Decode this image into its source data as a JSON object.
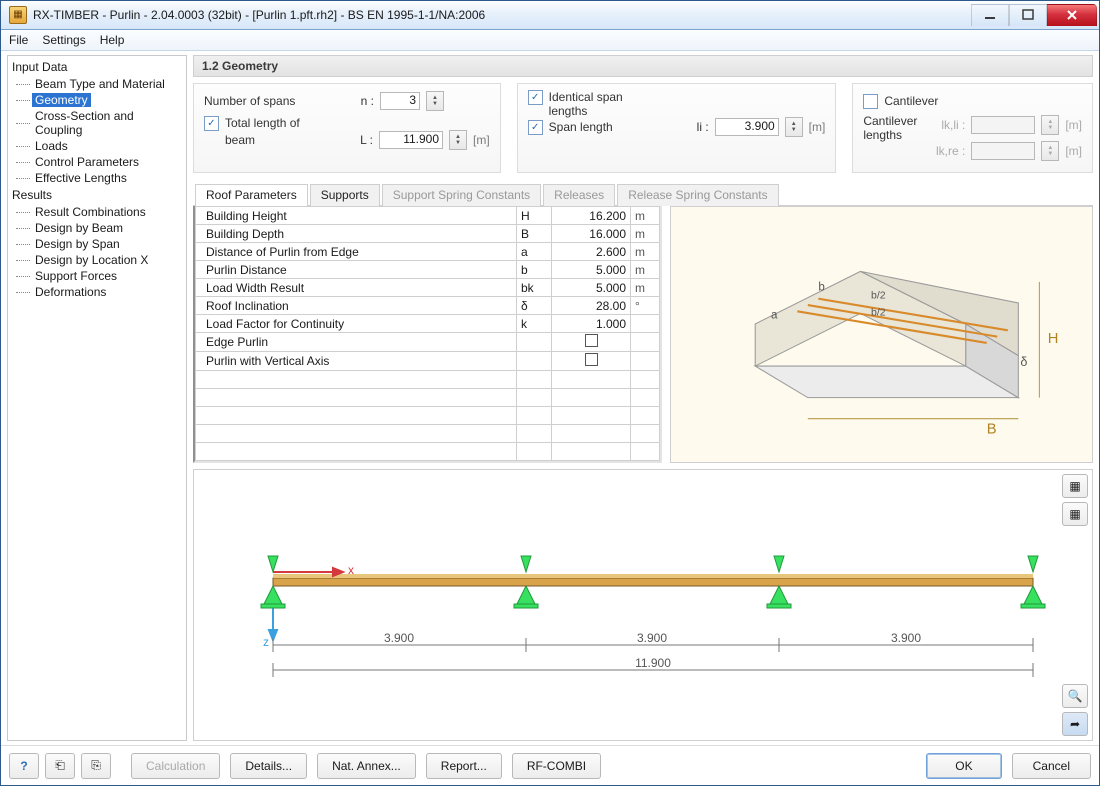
{
  "window": {
    "title": "RX-TIMBER - Purlin - 2.04.0003 (32bit) - [Purlin 1.pft.rh2] - BS EN 1995-1-1/NA:2006"
  },
  "menu": {
    "file": "File",
    "settings": "Settings",
    "help": "Help"
  },
  "tree": {
    "input": {
      "hdr": "Input Data",
      "items": [
        "Beam Type and Material",
        "Geometry",
        "Cross-Section and Coupling",
        "Loads",
        "Control Parameters",
        "Effective Lengths"
      ],
      "selected_index": 1
    },
    "results": {
      "hdr": "Results",
      "items": [
        "Result Combinations",
        "Design by Beam",
        "Design by Span",
        "Design by Location X",
        "Support Forces",
        "Deformations"
      ]
    }
  },
  "section": {
    "title": "1.2 Geometry"
  },
  "groups": {
    "spans": {
      "label": "Number of spans",
      "symbol": "n :",
      "value": "3"
    },
    "total_length": {
      "check": true,
      "label1": "Total length of",
      "label2": "beam",
      "symbol": "L :",
      "value": "11.900",
      "unit": "[m]"
    },
    "identical": {
      "check": true,
      "label1": "Identical span",
      "label2": "lengths"
    },
    "span_length": {
      "check": true,
      "label": "Span length",
      "symbol": "li :",
      "value": "3.900",
      "unit": "[m]"
    },
    "cantilever": {
      "check": false,
      "label": "Cantilever",
      "label2a": "Cantilever",
      "label2b": "lengths",
      "sym_li": "lk,li :",
      "sym_re": "lk,re :",
      "unit": "[m]"
    }
  },
  "tabs2": {
    "items": [
      "Roof Parameters",
      "Supports",
      "Support Spring Constants",
      "Releases",
      "Release Spring Constants"
    ],
    "active_index": 0
  },
  "params": {
    "rows": [
      {
        "name": "Building Height",
        "sym": "H",
        "val": "16.200",
        "un": "m"
      },
      {
        "name": "Building Depth",
        "sym": "B",
        "val": "16.000",
        "un": "m"
      },
      {
        "name": "Distance of Purlin from Edge",
        "sym": "a",
        "val": "2.600",
        "un": "m"
      },
      {
        "name": "Purlin Distance",
        "sym": "b",
        "val": "5.000",
        "un": "m"
      },
      {
        "name": "Load Width Result",
        "sym": "bk",
        "val": "5.000",
        "un": "m"
      },
      {
        "name": "Roof Inclination",
        "sym": "δ",
        "val": "28.00",
        "un": "°"
      },
      {
        "name": "Load Factor for Continuity",
        "sym": "k",
        "val": "1.000",
        "un": ""
      },
      {
        "name": "Edge Purlin",
        "sym": "",
        "val": "CHK",
        "un": ""
      },
      {
        "name": "Purlin with Vertical Axis",
        "sym": "",
        "val": "CHK",
        "un": ""
      }
    ],
    "blank_rows": 5
  },
  "diagram_labels": {
    "a": "a",
    "b": "b",
    "b2a": "b/2",
    "b2b": "b/2",
    "H": "H",
    "B": "B",
    "delta": "δ"
  },
  "beam": {
    "span1": "3.900",
    "span2": "3.900",
    "span3": "3.900",
    "total": "11.900",
    "x": "x",
    "z": "z"
  },
  "buttons": {
    "calculation": "Calculation",
    "details": "Details...",
    "annex": "Nat. Annex...",
    "report": "Report...",
    "rfcombi": "RF-COMBI",
    "ok": "OK",
    "cancel": "Cancel"
  }
}
